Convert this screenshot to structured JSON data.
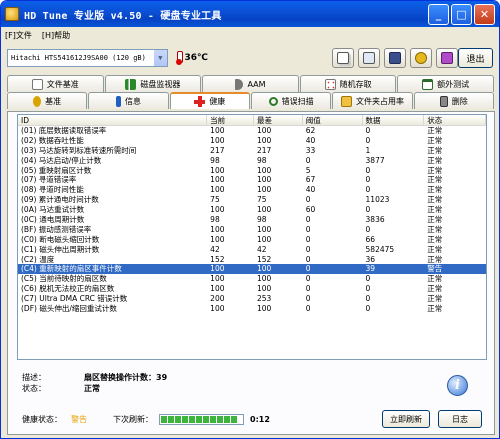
{
  "window": {
    "title": "HD Tune 专业版 v4.50 - 硬盘专业工具"
  },
  "menu": {
    "items": [
      "[F]文件",
      "[H]帮助"
    ]
  },
  "toolbar": {
    "drive": "Hitachi HTS541612J9SA00 (120 gB)",
    "temperature": "36℃",
    "exit_label": "退出"
  },
  "tabs": {
    "row1": [
      "文件基准",
      "磁盘监视器",
      "AAM",
      "随机存取",
      "额外测试"
    ],
    "row2": [
      "基准",
      "信息",
      "健康",
      "错误扫描",
      "文件夹占用率",
      "删除"
    ],
    "active": "健康"
  },
  "table": {
    "headers": [
      "ID",
      "当前",
      "最差",
      "阈值",
      "数据",
      "状态"
    ],
    "rows": [
      [
        "(01) 底层数据读取错误率",
        "100",
        "100",
        "62",
        "0",
        "正常"
      ],
      [
        "(02) 数据吞吐性能",
        "100",
        "100",
        "40",
        "0",
        "正常"
      ],
      [
        "(03) 马达旋转到标准转速所需时间",
        "217",
        "217",
        "33",
        "1",
        "正常"
      ],
      [
        "(04) 马达启动/停止计数",
        "98",
        "98",
        "0",
        "3877",
        "正常"
      ],
      [
        "(05) 重映射扇区计数",
        "100",
        "100",
        "5",
        "0",
        "正常"
      ],
      [
        "(07) 寻道错误率",
        "100",
        "100",
        "67",
        "0",
        "正常"
      ],
      [
        "(08) 寻道时间性能",
        "100",
        "100",
        "40",
        "0",
        "正常"
      ],
      [
        "(09) 累计通电时间计数",
        "75",
        "75",
        "0",
        "11023",
        "正常"
      ],
      [
        "(0A) 马达重试计数",
        "100",
        "100",
        "60",
        "0",
        "正常"
      ],
      [
        "(0C) 通电周期计数",
        "98",
        "98",
        "0",
        "3836",
        "正常"
      ],
      [
        "(BF) 振动感测错误率",
        "100",
        "100",
        "0",
        "0",
        "正常"
      ],
      [
        "(C0) 断电磁头缩回计数",
        "100",
        "100",
        "0",
        "66",
        "正常"
      ],
      [
        "(C1) 磁头伸出周期计数",
        "42",
        "42",
        "0",
        "582475",
        "正常"
      ],
      [
        "(C2) 温度",
        "152",
        "152",
        "0",
        "36",
        "正常"
      ],
      [
        "(C4) 重新映射的扇区事件计数",
        "100",
        "100",
        "0",
        "39",
        "警告"
      ],
      [
        "(C5) 当前待映射的扇区数",
        "100",
        "100",
        "0",
        "0",
        "正常"
      ],
      [
        "(C6) 脱机无法校正的扇区数",
        "100",
        "100",
        "0",
        "0",
        "正常"
      ],
      [
        "(C7) Ultra DMA CRC 错误计数",
        "200",
        "253",
        "0",
        "0",
        "正常"
      ],
      [
        "(DF) 磁头伸出/缩回重试计数",
        "100",
        "100",
        "0",
        "0",
        "正常"
      ]
    ],
    "selected_index": 14
  },
  "details": {
    "desc_label": "描述：",
    "desc_value": "扇区替换操作计数：39",
    "status_label": "状态：",
    "status_value": "正常"
  },
  "footer": {
    "health_label": "健康状态：",
    "health_value": "警告",
    "refresh_label": "下次刷新：",
    "progress_fraction": 1.0,
    "countdown": "0:12",
    "refresh_now_label": "立即刷新",
    "log_label": "日志"
  },
  "colors": {
    "accent": "#316ac5",
    "warning": "#e6a000",
    "title_bar": "#0a5fe8"
  }
}
